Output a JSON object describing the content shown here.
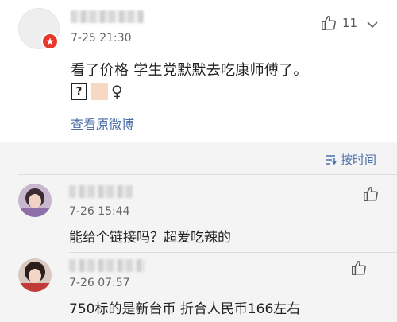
{
  "post": {
    "time": "7-25 21:30",
    "like_count": "11",
    "text": "看了价格 学生党默默去吃康师傅了。",
    "emoji_box_glyph": "?",
    "female_symbol": "♀",
    "view_original_label": "查看原微博"
  },
  "sort": {
    "label": "按时间",
    "icon": "sort-icon"
  },
  "replies": [
    {
      "time": "7-26 15:44",
      "text": "能给个链接吗？超爱吃辣的"
    },
    {
      "time": "7-26 07:57",
      "text": "750标的是新台币 折合人民币166左右"
    }
  ],
  "colors": {
    "link": "#4a6ea9",
    "badge": "#e8382c",
    "background": "#f4f4f4"
  }
}
